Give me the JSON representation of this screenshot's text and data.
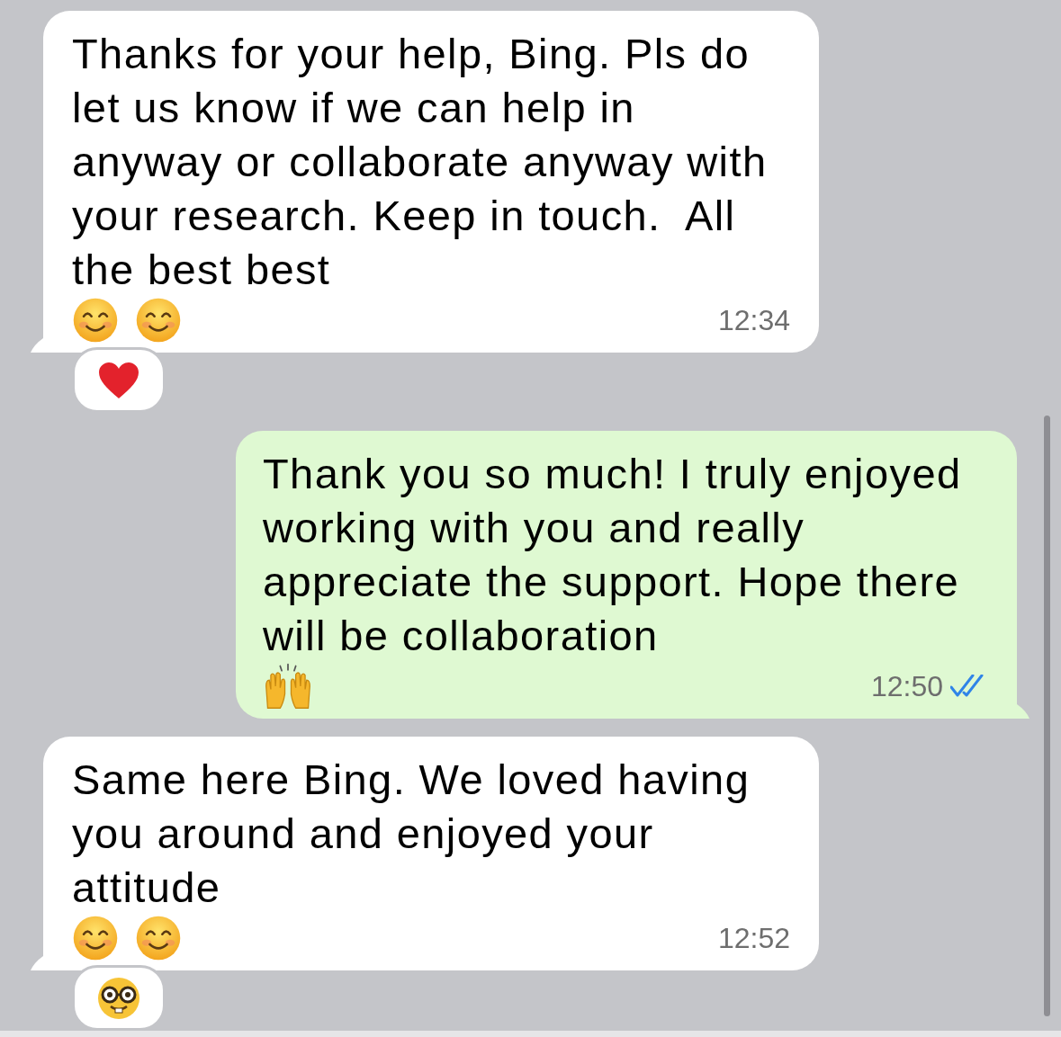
{
  "messages": [
    {
      "kind": "incoming",
      "text": "Thanks for your help, Bing. Pls do let us know if we can help in anyway or collaborate anyway with your research. Keep in touch.  All the best best",
      "emojis": [
        {
          "kind": "smiling-face"
        },
        {
          "kind": "smiling-face"
        }
      ],
      "time": "12:34",
      "reaction": {
        "kind": "heart"
      }
    },
    {
      "kind": "outgoing",
      "text": "Thank you so much! I truly enjoyed working with you and really appreciate the support. Hope there will be collaboration",
      "emojis": [
        {
          "kind": "raising-hands"
        }
      ],
      "time": "12:50",
      "read": true
    },
    {
      "kind": "incoming",
      "text": "Same here Bing. We loved having you around and enjoyed your attitude",
      "emojis": [
        {
          "kind": "smiling-face"
        },
        {
          "kind": "smiling-face"
        }
      ],
      "time": "12:52",
      "reaction": {
        "kind": "nerd-face"
      }
    }
  ]
}
